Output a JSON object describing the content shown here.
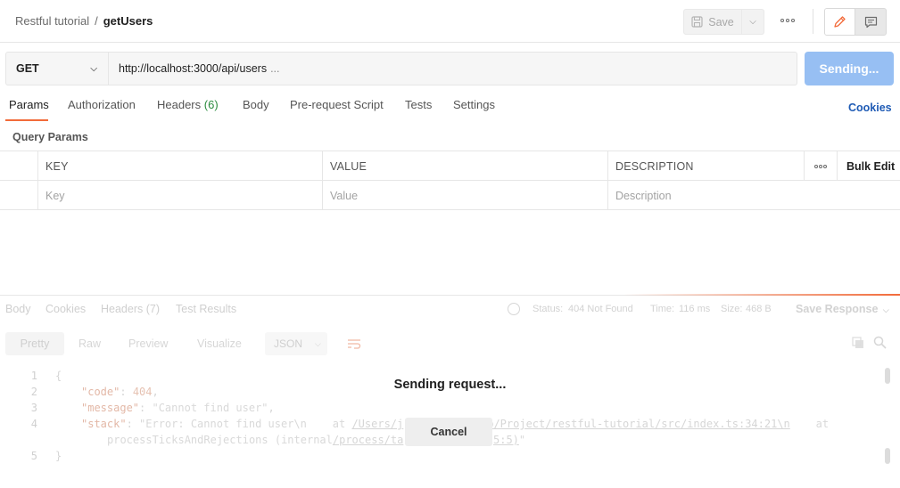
{
  "header": {
    "breadcrumb_parent": "Restful tutorial",
    "breadcrumb_sep": "/",
    "breadcrumb_current": "getUsers",
    "save_label": "Save"
  },
  "request": {
    "method": "GET",
    "url": "http://localhost:3000/api/users",
    "url_ellipsis": "...",
    "send_label": "Sending..."
  },
  "tabs": [
    {
      "label": "Params",
      "active": true
    },
    {
      "label": "Authorization"
    },
    {
      "label": "Headers",
      "count": "(6)"
    },
    {
      "label": "Body"
    },
    {
      "label": "Pre-request Script"
    },
    {
      "label": "Tests"
    },
    {
      "label": "Settings"
    }
  ],
  "cookies_label": "Cookies",
  "query_params": {
    "title": "Query Params",
    "columns": [
      "KEY",
      "VALUE",
      "DESCRIPTION"
    ],
    "bulk_edit": "Bulk Edit",
    "placeholders": {
      "key": "Key",
      "value": "Value",
      "description": "Description"
    }
  },
  "response": {
    "tabs": [
      "Body",
      "Cookies",
      "Headers (7)",
      "Test Results"
    ],
    "status_label": "Status:",
    "status_value": "404 Not Found",
    "time_label": "Time:",
    "time_value": "116 ms",
    "size_label": "Size:",
    "size_value": "468 B",
    "save_response": "Save Response",
    "formats": [
      "Pretty",
      "Raw",
      "Preview",
      "Visualize"
    ],
    "format_type": "JSON",
    "code": {
      "line1": "{",
      "code_key": "\"code\"",
      "code_val": "404",
      "message_key": "\"message\"",
      "message_val": "\"Cannot find user\"",
      "stack_key": "\"stack\"",
      "stack_val_a": "\"Error: Cannot find user\\n    at ",
      "stack_link_a": "/Users/j",
      "stack_link_b": "op/Project/restful-tutorial/src/index.ts:34:21\\n",
      "stack_val_b": "    at",
      "stack_val_c": "processTicksAndRejections (internal",
      "stack_link_c": "/process/ta",
      "stack_link_d": "5:5)",
      "stack_end": "\"",
      "line5": "}"
    },
    "line_numbers": [
      "1",
      "2",
      "3",
      "4",
      "5"
    ]
  },
  "overlay": {
    "message": "Sending request...",
    "cancel_label": "Cancel"
  },
  "colors": {
    "accent": "#f26b3a",
    "send_button": "#97bff3",
    "link": "#1f5bb5",
    "count": "#2c8c3f"
  }
}
